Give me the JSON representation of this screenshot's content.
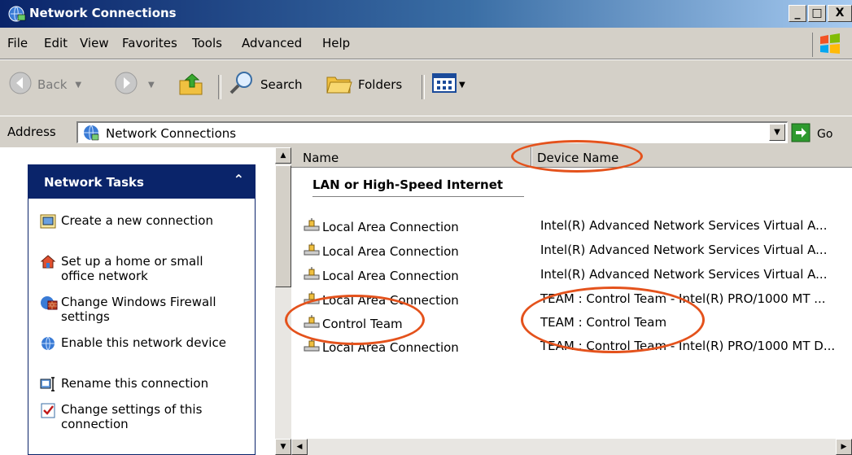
{
  "window": {
    "title": "Network Connections",
    "controls": [
      "_",
      "□",
      "X"
    ]
  },
  "menu": [
    "File",
    "Edit",
    "View",
    "Favorites",
    "Tools",
    "Advanced",
    "Help"
  ],
  "toolbar": {
    "back": "Back",
    "search": "Search",
    "folders": "Folders"
  },
  "address": {
    "label": "Address",
    "value": "Network Connections",
    "go": "Go"
  },
  "tasks": {
    "title": "Network Tasks",
    "items": [
      {
        "label": "Create a new connection",
        "icon": "new-connection-icon"
      },
      {
        "label": "Set up a home or small office network",
        "icon": "home-network-icon"
      },
      {
        "label": "Change Windows Firewall settings",
        "icon": "firewall-icon"
      },
      {
        "label": "Enable this network device",
        "icon": "network-globe-icon"
      },
      {
        "label": "Rename this connection",
        "icon": "rename-icon"
      },
      {
        "label": "Change settings of this connection",
        "icon": "settings-check-icon"
      }
    ]
  },
  "list": {
    "columns": [
      "Name",
      "Device Name"
    ],
    "group": "LAN or High-Speed Internet",
    "rows": [
      {
        "name": "Local Area Connection",
        "device": "Intel(R) Advanced Network Services Virtual A..."
      },
      {
        "name": "Local Area Connection",
        "device": "Intel(R) Advanced Network Services Virtual A..."
      },
      {
        "name": "Local Area Connection",
        "device": "Intel(R) Advanced Network Services Virtual A..."
      },
      {
        "name": "Local Area Connection",
        "device": "TEAM : Control Team - Intel(R) PRO/1000 MT ..."
      },
      {
        "name": "Control Team",
        "device": "TEAM : Control Team"
      },
      {
        "name": "Local Area Connection",
        "device": "TEAM : Control Team - Intel(R) PRO/1000 MT D..."
      }
    ]
  },
  "colors": {
    "titlebar": "#0a246a",
    "annotation": "#e4521c",
    "chrome": "#d4d0c8"
  }
}
